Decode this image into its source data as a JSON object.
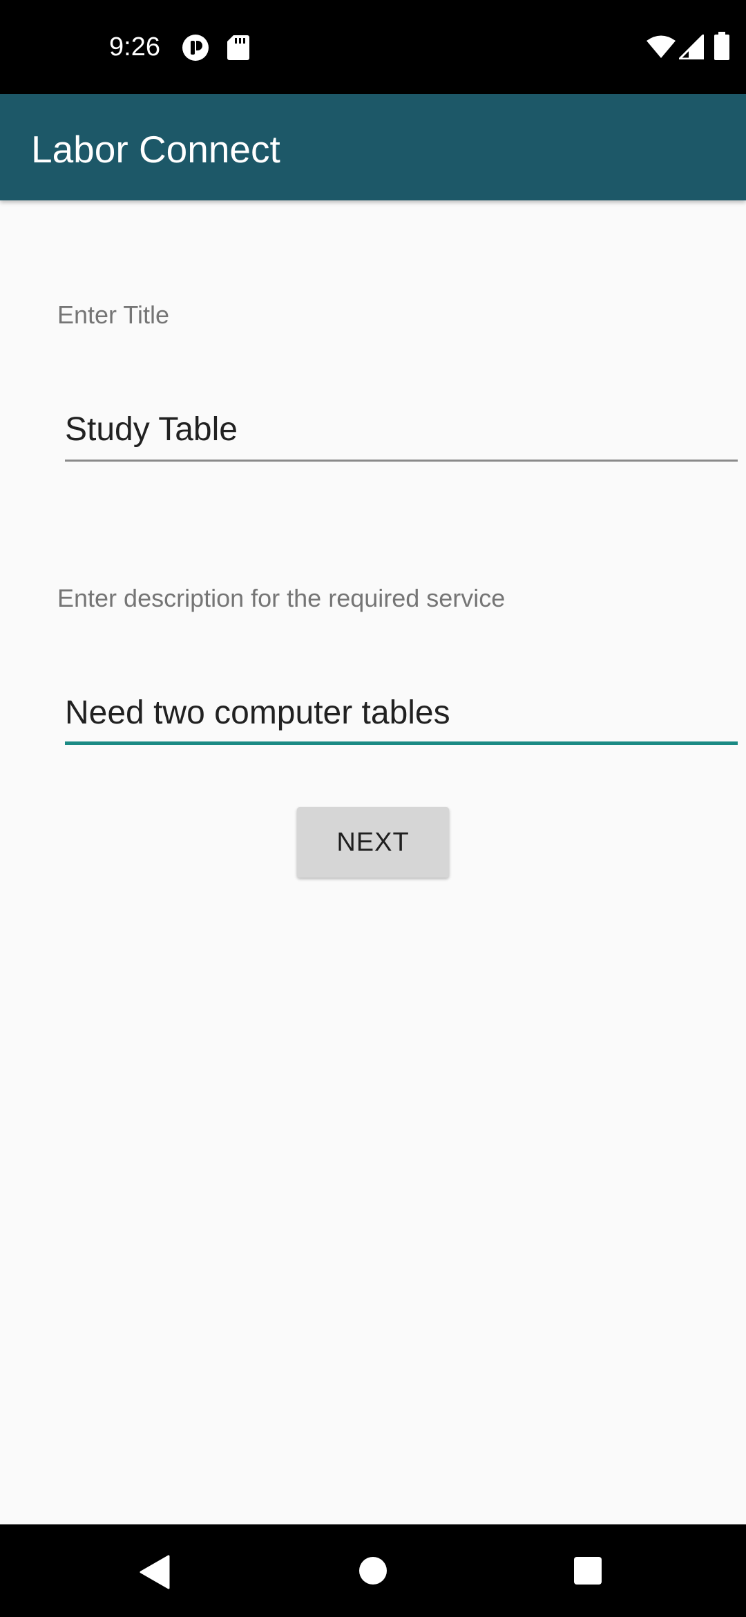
{
  "status_bar": {
    "time": "9:26",
    "left_icons": [
      "notification-app-icon",
      "sd-card-icon"
    ],
    "right_icons": [
      "wifi-icon",
      "signal-icon",
      "battery-icon"
    ]
  },
  "app_bar": {
    "title": "Labor Connect",
    "color": "#1d5868"
  },
  "form": {
    "title_label": "Enter Title",
    "title_value": "Study Table",
    "description_label": "Enter description for the required service",
    "description_value": "Need two computer tables",
    "next_label": "NEXT",
    "focus_color": "#1b8a84"
  },
  "nav_bar": {
    "buttons": [
      "back-icon",
      "home-icon",
      "recents-icon"
    ]
  }
}
